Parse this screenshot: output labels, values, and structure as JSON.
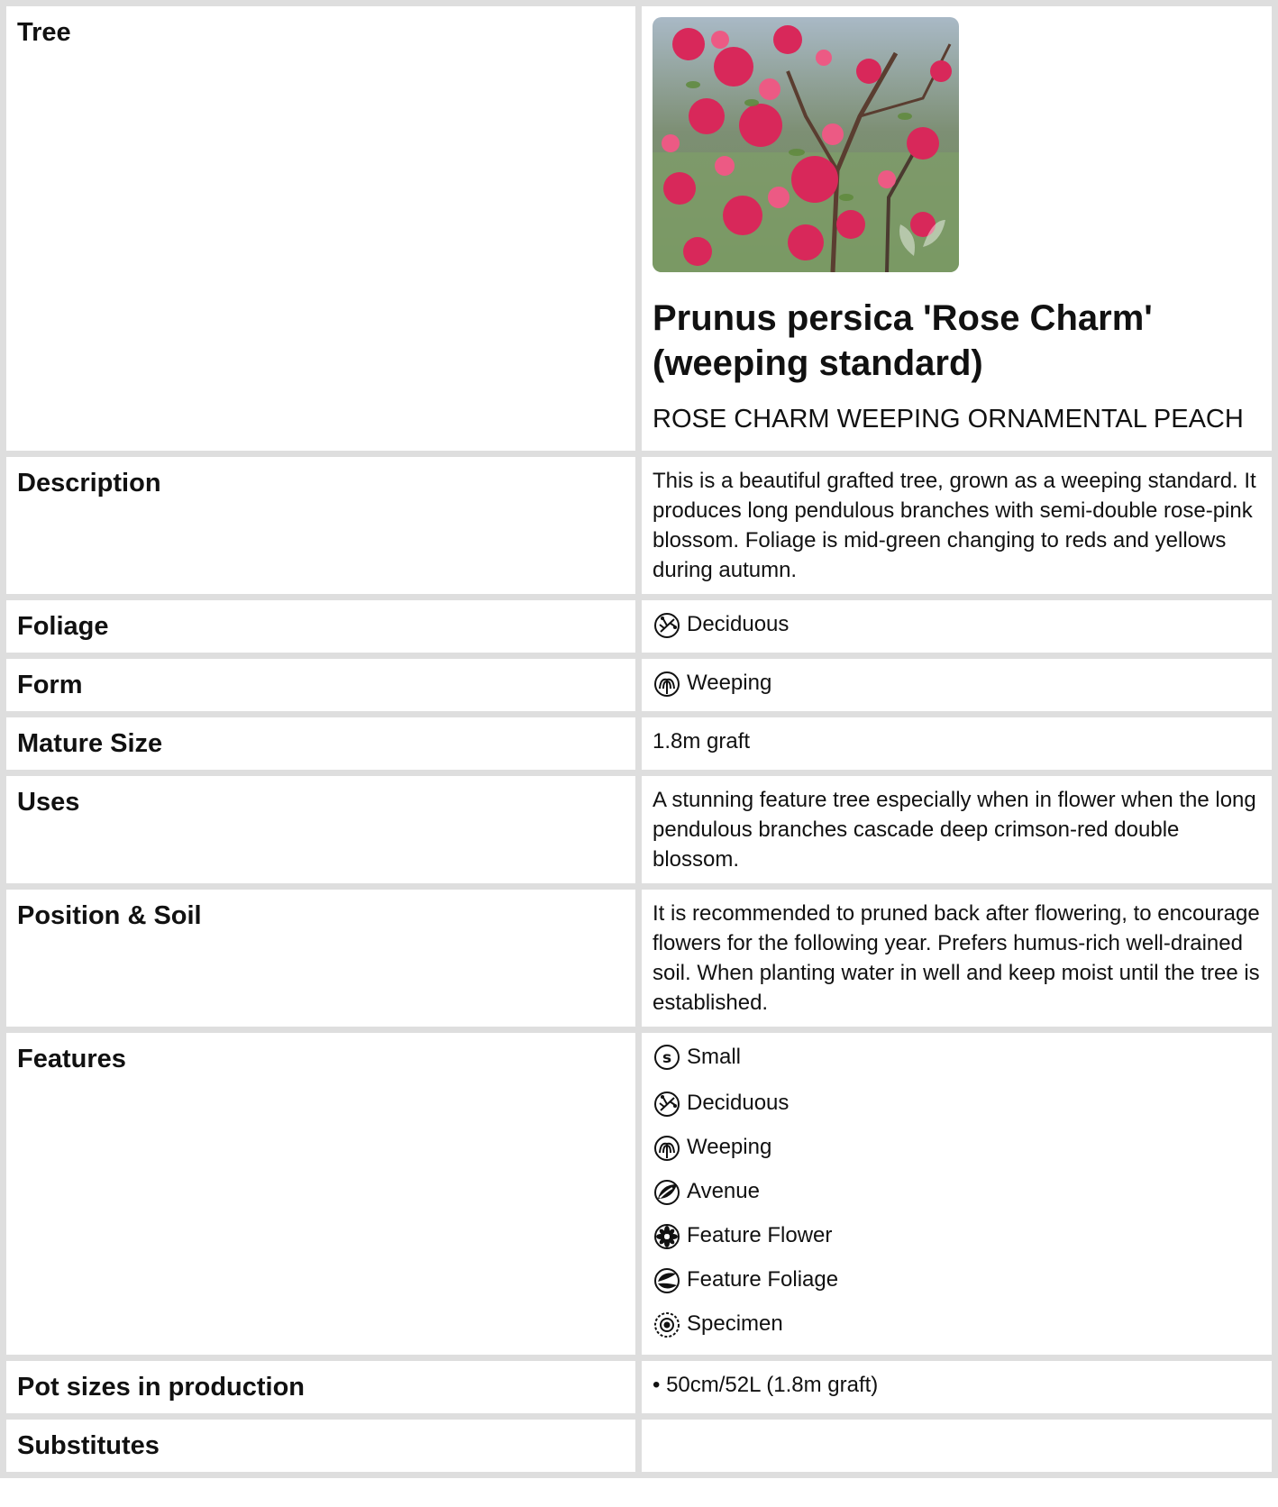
{
  "rows": {
    "tree": {
      "label": "Tree"
    },
    "description": {
      "label": "Description",
      "value": "This is a beautiful grafted tree, grown as a weeping standard. It produces long pendulous branches with semi-double rose-pink blossom. Foliage is mid-green changing to reds and yellows during autumn."
    },
    "foliage": {
      "label": "Foliage",
      "value": "Deciduous",
      "icon": "deciduous-icon"
    },
    "form": {
      "label": "Form",
      "value": "Weeping",
      "icon": "weeping-icon"
    },
    "mature_size": {
      "label": "Mature Size",
      "value": "1.8m graft"
    },
    "uses": {
      "label": "Uses",
      "value": "A stunning feature tree especially when in flower when the long pendulous branches cascade deep crimson-red double blossom."
    },
    "position_soil": {
      "label": "Position & Soil",
      "value": "It is recommended to pruned back after flowering, to encourage flowers for the following year. Prefers humus-rich well-drained soil. When planting water in well and keep moist until the tree is established."
    },
    "features": {
      "label": "Features",
      "items": [
        {
          "label": "Small",
          "icon": "small-s-icon"
        },
        {
          "label": "Deciduous",
          "icon": "deciduous-icon"
        },
        {
          "label": "Weeping",
          "icon": "weeping-icon"
        },
        {
          "label": "Avenue",
          "icon": "avenue-icon"
        },
        {
          "label": "Feature Flower",
          "icon": "flower-icon"
        },
        {
          "label": "Feature Foliage",
          "icon": "foliage-icon"
        },
        {
          "label": "Specimen",
          "icon": "specimen-icon"
        }
      ]
    },
    "pot_sizes": {
      "label": "Pot sizes in production",
      "value": "• 50cm/52L (1.8m graft)"
    },
    "substitutes": {
      "label": "Substitutes",
      "value": ""
    }
  },
  "plant": {
    "botanical_name": "Prunus persica 'Rose Charm' (weeping standard)",
    "common_name": "ROSE CHARM WEEPING ORNAMENTAL PEACH",
    "photo": "pink-blossom-tree-photo"
  },
  "colors": {
    "grid": "#dedede",
    "text": "#111111",
    "blossom": "#d8285a"
  }
}
